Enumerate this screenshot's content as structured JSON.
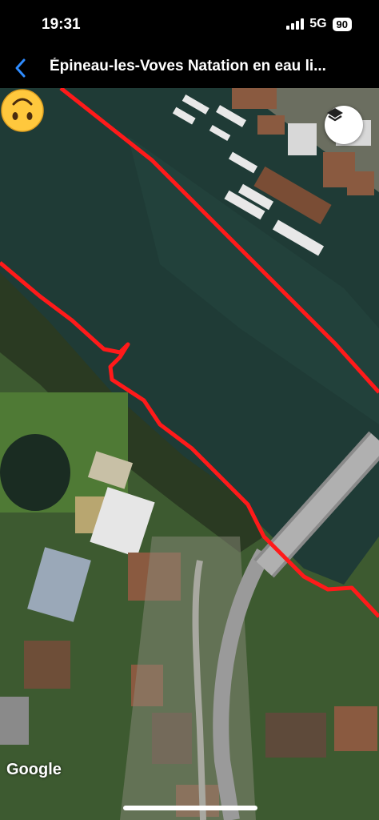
{
  "status_bar": {
    "time": "19:31",
    "network": "5G",
    "battery": "90"
  },
  "nav": {
    "title": "Épineau-les-Voves Natation en eau li...",
    "back_icon": "chevron-left-icon"
  },
  "map": {
    "layers_icon": "layers-icon",
    "marker_icon": "upside-down-face-emoji",
    "attribution": "Google",
    "route_color": "#ff1a1a",
    "water_color": "#1f3b36"
  }
}
